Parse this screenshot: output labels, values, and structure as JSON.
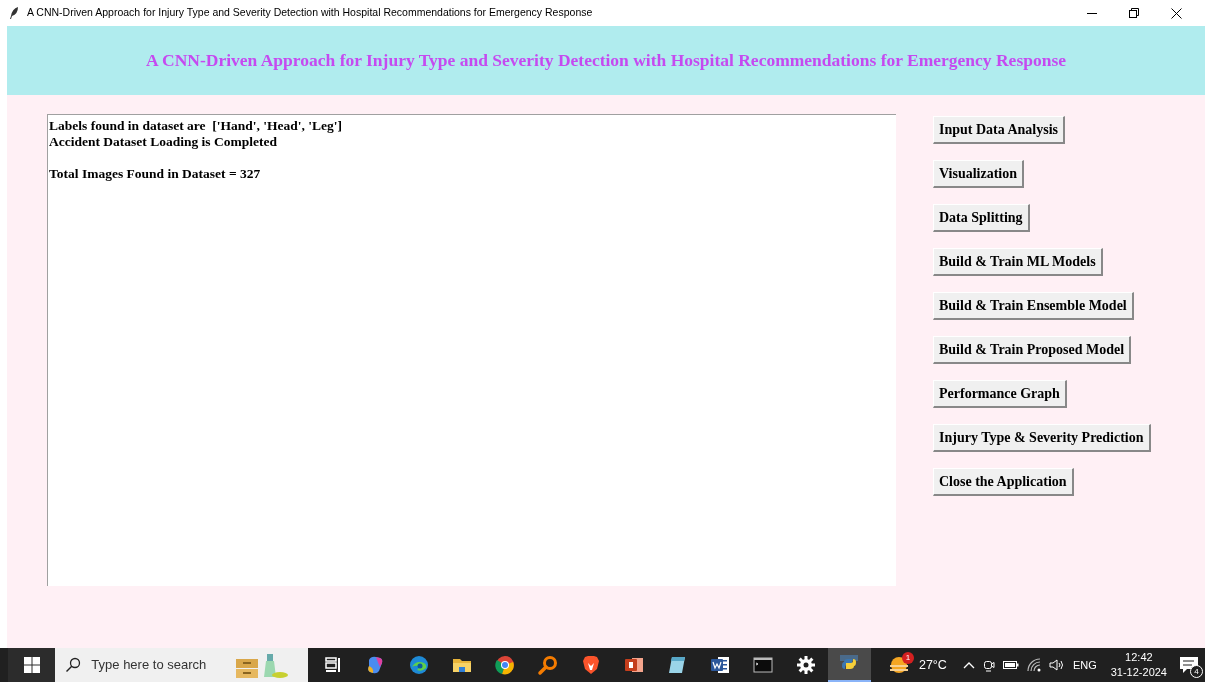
{
  "window": {
    "title": "A CNN-Driven Approach for Injury Type and Severity Detection with Hospital Recommendations for Emergency Response"
  },
  "header": {
    "title": "A CNN-Driven Approach for Injury Type and Severity Detection with Hospital Recommendations for Emergency Response"
  },
  "output": {
    "paragraphs": [
      [
        "Labels found in dataset are  ['Hand', 'Head', 'Leg']",
        "Accident Dataset Loading is Completed"
      ],
      [
        "Total Images Found in Dataset = 327"
      ]
    ]
  },
  "buttons": [
    "Input Data Analysis",
    "Visualization",
    "Data Splitting",
    "Build & Train ML Models",
    "Build & Train Ensemble Model",
    "Build & Train Proposed Model",
    "Performance Graph",
    "Injury Type & Severity Prediction",
    "Close the Application"
  ],
  "taskbar": {
    "search": {
      "placeholder": "Type here to search"
    },
    "apps": [
      {
        "kind": "taskview",
        "selected": false
      },
      {
        "kind": "copilot",
        "selected": false
      },
      {
        "kind": "edge",
        "selected": false
      },
      {
        "kind": "folder",
        "selected": false
      },
      {
        "kind": "chrome",
        "selected": false
      },
      {
        "kind": "magnifier",
        "selected": false
      },
      {
        "kind": "brave",
        "selected": false
      },
      {
        "kind": "powerpoint",
        "selected": false
      },
      {
        "kind": "notepad",
        "selected": false
      },
      {
        "kind": "word",
        "selected": false
      },
      {
        "kind": "terminal",
        "selected": false
      },
      {
        "kind": "settings",
        "selected": false
      },
      {
        "kind": "python",
        "selected": true
      }
    ],
    "weather": {
      "badge": "1",
      "temperature": "27°C"
    },
    "language": "ENG",
    "time": "12:42",
    "date": "31-12-2024",
    "notifications": "4"
  }
}
